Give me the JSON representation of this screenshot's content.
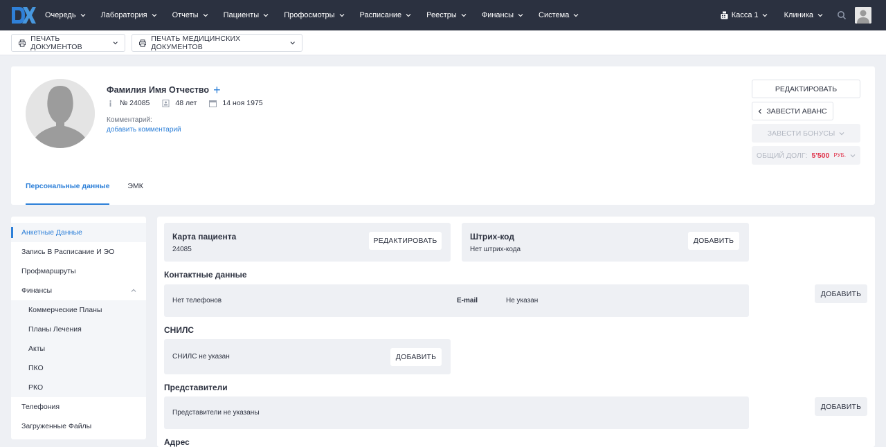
{
  "nav": {
    "items": [
      "Очередь",
      "Лаборатория",
      "Отчеты",
      "Пациенты",
      "Профосмотры",
      "Расписание",
      "Реестры",
      "Финансы",
      "Система"
    ],
    "kassa": "Касса 1",
    "clinic": "Клиника"
  },
  "print": {
    "docs": "ПЕЧАТЬ ДОКУМЕНТОВ",
    "med_docs": "ПЕЧАТЬ МЕДИЦИНСКИХ ДОКУМЕНТОВ"
  },
  "patient": {
    "name": "Фамилия Имя Отчество",
    "plus": "+",
    "number": "№ 24085",
    "age": "48 лет",
    "birthdate": "14 ноя 1975",
    "comment_label": "Комментарий:",
    "comment_link": "добавить комментарий"
  },
  "actions": {
    "edit": "РЕДАКТИРОВАТЬ",
    "avans": "ЗАВЕСТИ АВАНС",
    "bonus": "ЗАВЕСТИ БОНУСЫ",
    "debt_label": "ОБЩИЙ ДОЛГ:",
    "debt_value": "5'500",
    "debt_currency": "РУБ."
  },
  "tabs": [
    "Персональные данные",
    "ЭМК"
  ],
  "sidebar": {
    "items": [
      "Анкетные Данные",
      "Запись В Расписание И ЭО",
      "Профмаршруты",
      "Финансы",
      "Коммерческие Планы",
      "Планы Лечения",
      "Акты",
      "ПКО",
      "РКО",
      "Телефония",
      "Загруженные Файлы"
    ]
  },
  "card": {
    "title": "Карта пациента",
    "number": "24085",
    "edit": "РЕДАКТИРОВАТЬ"
  },
  "barcode": {
    "title": "Штрих-код",
    "value": "Нет штрих-кода",
    "add": "ДОБАВИТЬ"
  },
  "contacts": {
    "title": "Контактные данные",
    "phones": "Нет телефонов",
    "email_label": "E-mail",
    "email_value": "Не указан",
    "add": "ДОБАВИТЬ"
  },
  "snils": {
    "title": "СНИЛС",
    "value": "СНИЛС не указан",
    "add": "ДОБАВИТЬ"
  },
  "reps": {
    "title": "Представители",
    "value": "Представители не указаны",
    "add": "ДОБАВИТЬ"
  },
  "address": {
    "title": "Адрес"
  }
}
